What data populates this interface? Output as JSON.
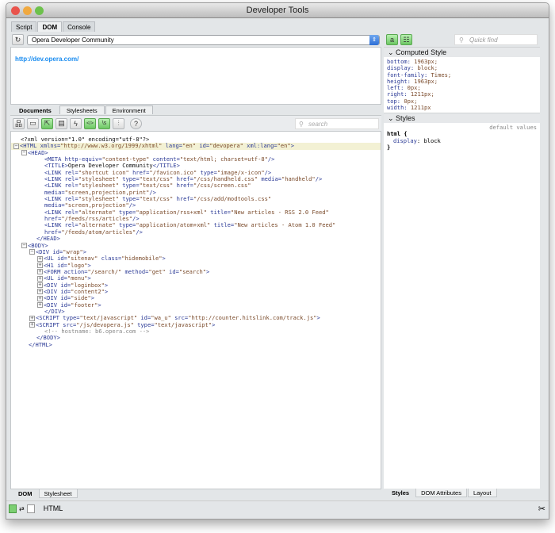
{
  "window": {
    "title": "Developer Tools"
  },
  "main_tabs": [
    "Script",
    "DOM",
    "Console"
  ],
  "address": {
    "selected": "Opera Developer Community",
    "url": "http://dev.opera.com/"
  },
  "doc_tabs": [
    "Documents",
    "Stylesheets",
    "Environment"
  ],
  "toolbar": {
    "search_placeholder": "search"
  },
  "code_lines": [
    {
      "i": 0,
      "g": "",
      "p": [
        [
          "x",
          "<?xml version=\"1.0\" encoding=\"utf-8\"?>"
        ]
      ]
    },
    {
      "i": 0,
      "g": "-",
      "s": 1,
      "p": [
        [
          "t",
          "<HTML "
        ],
        [
          "a",
          "xmlns="
        ],
        [
          "v",
          "\"http://www.w3.org/1999/xhtml\" "
        ],
        [
          "a",
          "lang="
        ],
        [
          "v",
          "\"en\" "
        ],
        [
          "a",
          "id="
        ],
        [
          "v",
          "\"devopera\" "
        ],
        [
          "a",
          "xml:lang="
        ],
        [
          "v",
          "\"en\""
        ],
        [
          "t",
          ">"
        ]
      ]
    },
    {
      "i": 1,
      "g": "-",
      "p": [
        [
          "t",
          "<HEAD>"
        ]
      ]
    },
    {
      "i": 3,
      "g": "",
      "p": [
        [
          "t",
          "<META "
        ],
        [
          "a",
          "http-equiv="
        ],
        [
          "v",
          "\"content-type\" "
        ],
        [
          "a",
          "content="
        ],
        [
          "v",
          "\"text/html; charset=utf-8\""
        ],
        [
          "t",
          "/>"
        ]
      ]
    },
    {
      "i": 3,
      "g": "",
      "p": [
        [
          "t",
          "<TITLE>"
        ],
        [
          "x",
          "Opera Developer Community"
        ],
        [
          "t",
          "</TITLE>"
        ]
      ]
    },
    {
      "i": 3,
      "g": "",
      "p": [
        [
          "t",
          "<LINK "
        ],
        [
          "a",
          "rel="
        ],
        [
          "v",
          "\"shortcut icon\" "
        ],
        [
          "a",
          "href="
        ],
        [
          "v",
          "\"/favicon.ico\" "
        ],
        [
          "a",
          "type="
        ],
        [
          "v",
          "\"image/x-icon\""
        ],
        [
          "t",
          "/>"
        ]
      ]
    },
    {
      "i": 3,
      "g": "",
      "p": [
        [
          "t",
          "<LINK "
        ],
        [
          "a",
          "rel="
        ],
        [
          "v",
          "\"stylesheet\" "
        ],
        [
          "a",
          "type="
        ],
        [
          "v",
          "\"text/css\" "
        ],
        [
          "a",
          "href="
        ],
        [
          "v",
          "\"/css/handheld.css\" "
        ],
        [
          "a",
          "media="
        ],
        [
          "v",
          "\"handheld\""
        ],
        [
          "t",
          "/>"
        ]
      ]
    },
    {
      "i": 3,
      "g": "",
      "p": [
        [
          "t",
          "<LINK "
        ],
        [
          "a",
          "rel="
        ],
        [
          "v",
          "\"stylesheet\" "
        ],
        [
          "a",
          "type="
        ],
        [
          "v",
          "\"text/css\" "
        ],
        [
          "a",
          "href="
        ],
        [
          "v",
          "\"/css/screen.css\""
        ]
      ]
    },
    {
      "i": 3,
      "g": "",
      "p": [
        [
          "a",
          "media="
        ],
        [
          "v",
          "\"screen,projection,print\""
        ],
        [
          "t",
          "/>"
        ]
      ]
    },
    {
      "i": 3,
      "g": "",
      "p": [
        [
          "t",
          "<LINK "
        ],
        [
          "a",
          "rel="
        ],
        [
          "v",
          "\"stylesheet\" "
        ],
        [
          "a",
          "type="
        ],
        [
          "v",
          "\"text/css\" "
        ],
        [
          "a",
          "href="
        ],
        [
          "v",
          "\"/css/add/modtools.css\""
        ]
      ]
    },
    {
      "i": 3,
      "g": "",
      "p": [
        [
          "a",
          "media="
        ],
        [
          "v",
          "\"screen,projection\""
        ],
        [
          "t",
          "/>"
        ]
      ]
    },
    {
      "i": 3,
      "g": "",
      "p": [
        [
          "t",
          "<LINK "
        ],
        [
          "a",
          "rel="
        ],
        [
          "v",
          "\"alternate\" "
        ],
        [
          "a",
          "type="
        ],
        [
          "v",
          "\"application/rss+xml\" "
        ],
        [
          "a",
          "title="
        ],
        [
          "v",
          "\"New articles - RSS 2.0 Feed\""
        ]
      ]
    },
    {
      "i": 3,
      "g": "",
      "p": [
        [
          "a",
          "href="
        ],
        [
          "v",
          "\"/feeds/rss/articles\""
        ],
        [
          "t",
          "/>"
        ]
      ]
    },
    {
      "i": 3,
      "g": "",
      "p": [
        [
          "t",
          "<LINK "
        ],
        [
          "a",
          "rel="
        ],
        [
          "v",
          "\"alternate\" "
        ],
        [
          "a",
          "type="
        ],
        [
          "v",
          "\"application/atom+xml\" "
        ],
        [
          "a",
          "title="
        ],
        [
          "v",
          "\"New articles - Atom 1.0 Feed\""
        ]
      ]
    },
    {
      "i": 3,
      "g": "",
      "p": [
        [
          "a",
          "href="
        ],
        [
          "v",
          "\"/feeds/atom/articles\""
        ],
        [
          "t",
          "/>"
        ]
      ]
    },
    {
      "i": 2,
      "g": "",
      "p": [
        [
          "t",
          "</HEAD>"
        ]
      ]
    },
    {
      "i": 1,
      "g": "-",
      "p": [
        [
          "t",
          "<BODY>"
        ]
      ]
    },
    {
      "i": 2,
      "g": "-",
      "p": [
        [
          "t",
          "<DIV "
        ],
        [
          "a",
          "id="
        ],
        [
          "v",
          "\"wrap\""
        ],
        [
          "t",
          ">"
        ]
      ]
    },
    {
      "i": 3,
      "g": "+",
      "p": [
        [
          "t",
          "<UL "
        ],
        [
          "a",
          "id="
        ],
        [
          "v",
          "\"sitenav\" "
        ],
        [
          "a",
          "class="
        ],
        [
          "v",
          "\"hidemobile\""
        ],
        [
          "t",
          ">"
        ]
      ]
    },
    {
      "i": 3,
      "g": "+",
      "p": [
        [
          "t",
          "<H1 "
        ],
        [
          "a",
          "id="
        ],
        [
          "v",
          "\"logo\""
        ],
        [
          "t",
          ">"
        ]
      ]
    },
    {
      "i": 3,
      "g": "+",
      "p": [
        [
          "t",
          "<FORM "
        ],
        [
          "a",
          "action="
        ],
        [
          "v",
          "\"/search/\" "
        ],
        [
          "a",
          "method="
        ],
        [
          "v",
          "\"get\" "
        ],
        [
          "a",
          "id="
        ],
        [
          "v",
          "\"search\""
        ],
        [
          "t",
          ">"
        ]
      ]
    },
    {
      "i": 3,
      "g": "+",
      "p": [
        [
          "t",
          "<UL "
        ],
        [
          "a",
          "id="
        ],
        [
          "v",
          "\"menu\""
        ],
        [
          "t",
          ">"
        ]
      ]
    },
    {
      "i": 3,
      "g": "+",
      "p": [
        [
          "t",
          "<DIV "
        ],
        [
          "a",
          "id="
        ],
        [
          "v",
          "\"loginbox\""
        ],
        [
          "t",
          ">"
        ]
      ]
    },
    {
      "i": 3,
      "g": "+",
      "p": [
        [
          "t",
          "<DIV "
        ],
        [
          "a",
          "id="
        ],
        [
          "v",
          "\"content2\""
        ],
        [
          "t",
          ">"
        ]
      ]
    },
    {
      "i": 3,
      "g": "+",
      "p": [
        [
          "t",
          "<DIV "
        ],
        [
          "a",
          "id="
        ],
        [
          "v",
          "\"side\""
        ],
        [
          "t",
          ">"
        ]
      ]
    },
    {
      "i": 3,
      "g": "+",
      "p": [
        [
          "t",
          "<DIV "
        ],
        [
          "a",
          "id="
        ],
        [
          "v",
          "\"footer\""
        ],
        [
          "t",
          ">"
        ]
      ]
    },
    {
      "i": 3,
      "g": "",
      "p": [
        [
          "t",
          "</DIV>"
        ]
      ]
    },
    {
      "i": 2,
      "g": "+",
      "p": [
        [
          "t",
          "<SCRIPT "
        ],
        [
          "a",
          "type="
        ],
        [
          "v",
          "\"text/javascript\" "
        ],
        [
          "a",
          "id="
        ],
        [
          "v",
          "\"wa_u\" "
        ],
        [
          "a",
          "src="
        ],
        [
          "v",
          "\"http://counter.hitslink.com/track.js\""
        ],
        [
          "t",
          ">"
        ]
      ]
    },
    {
      "i": 2,
      "g": "+",
      "p": [
        [
          "t",
          "<SCRIPT "
        ],
        [
          "a",
          "src="
        ],
        [
          "v",
          "\"/js/devopera.js\" "
        ],
        [
          "a",
          "type="
        ],
        [
          "v",
          "\"text/javascript\""
        ],
        [
          "t",
          ">"
        ]
      ]
    },
    {
      "i": 3,
      "g": "",
      "p": [
        [
          "c",
          "<!-- hostname: b6.opera.com -->"
        ]
      ]
    },
    {
      "i": 2,
      "g": "",
      "p": [
        [
          "t",
          "</BODY>"
        ]
      ]
    },
    {
      "i": 1,
      "g": "",
      "p": [
        [
          "t",
          "</HTML>"
        ]
      ]
    }
  ],
  "left_bottom_tabs": [
    "DOM",
    "Stylesheet"
  ],
  "right": {
    "quick_find_placeholder": "Quick find",
    "computed_title": "Computed Style",
    "computed": [
      [
        "bottom",
        "1963px;"
      ],
      [
        "display",
        "block;"
      ],
      [
        "font-family",
        "Times;"
      ],
      [
        "height",
        "1963px;"
      ],
      [
        "left",
        "0px;"
      ],
      [
        "right",
        "1211px;"
      ],
      [
        "top",
        "0px;"
      ],
      [
        "width",
        "1211px"
      ]
    ],
    "styles_title": "Styles",
    "default_values": "default values",
    "rule_selector": "html {",
    "rule_prop": "display",
    "rule_value": "block",
    "rule_close": "}",
    "tabs": [
      "Styles",
      "DOM Attributes",
      "Layout"
    ]
  },
  "status": {
    "text": "HTML"
  }
}
